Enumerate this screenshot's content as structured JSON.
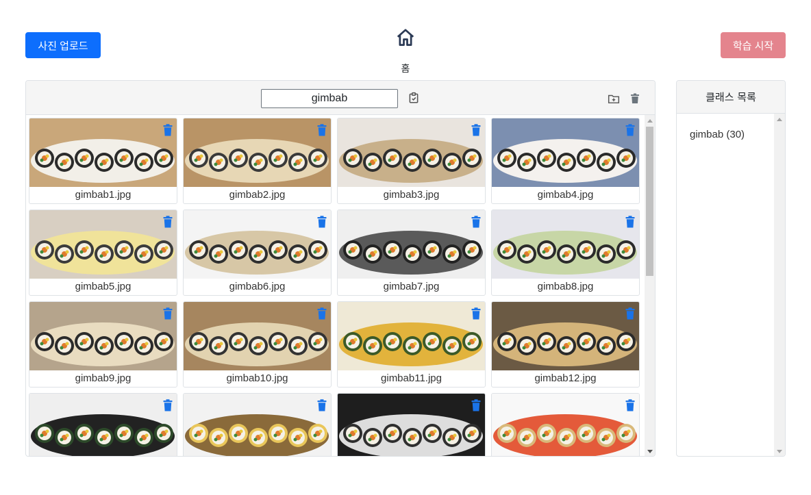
{
  "toolbar": {
    "upload_label": "사진 업로드",
    "train_label": "학습 시작",
    "home_label": "홈"
  },
  "gallery": {
    "class_name_value": "gimbab",
    "images": [
      {
        "name": "gimbab1.jpg"
      },
      {
        "name": "gimbab2.jpg"
      },
      {
        "name": "gimbab3.jpg"
      },
      {
        "name": "gimbab4.jpg"
      },
      {
        "name": "gimbab5.jpg"
      },
      {
        "name": "gimbab6.jpg"
      },
      {
        "name": "gimbab7.jpg"
      },
      {
        "name": "gimbab8.jpg"
      },
      {
        "name": "gimbab9.jpg"
      },
      {
        "name": "gimbab10.jpg"
      },
      {
        "name": "gimbab11.jpg"
      },
      {
        "name": "gimbab12.jpg"
      },
      {
        "name": ""
      },
      {
        "name": ""
      },
      {
        "name": ""
      },
      {
        "name": ""
      }
    ]
  },
  "class_panel": {
    "title": "클래스 목록",
    "items": [
      {
        "label": "gimbab (30)"
      }
    ]
  },
  "colors": {
    "primary": "#0d6efd",
    "train_button": "#e4848d",
    "trash_icon": "#1a73e8"
  }
}
